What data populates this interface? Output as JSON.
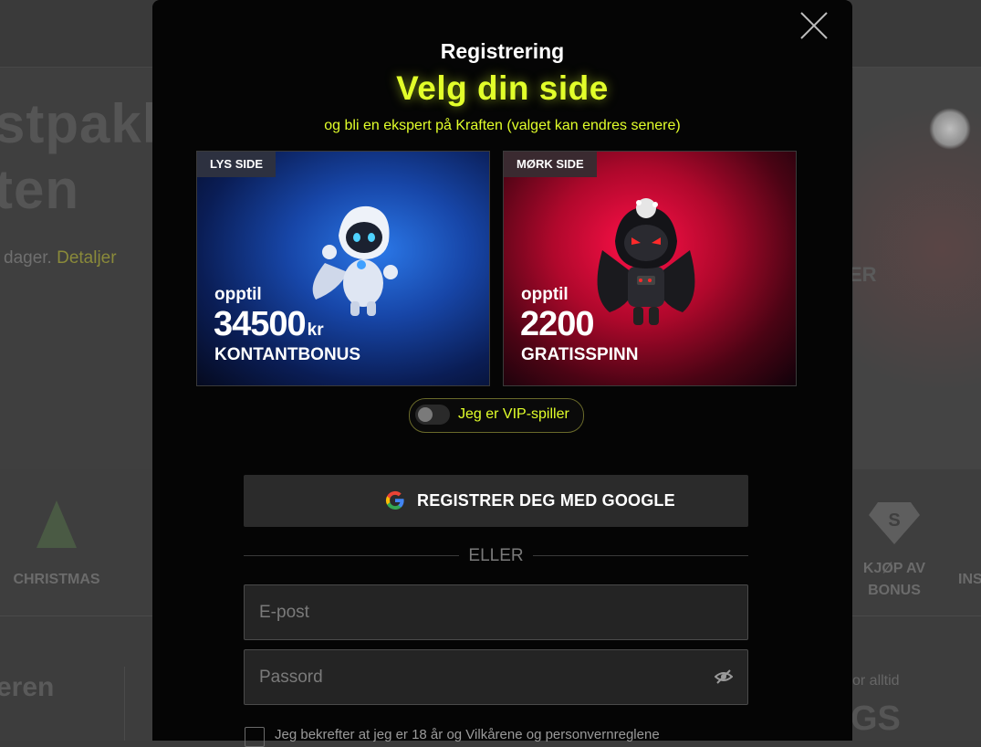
{
  "background": {
    "hero_title_line1": "stpakl",
    "hero_title_line2": "ten",
    "hero_sub": "dager.",
    "hero_link": "Detaljer",
    "right_letters": "ER",
    "categories": [
      {
        "label": "CHRISTMAS"
      },
      {
        "label": "KJØP AV BONUS"
      },
      {
        "label": "INS"
      }
    ],
    "bottom_left": "eren",
    "bottom_right_small": "or alltid",
    "bottom_right_big": "GS"
  },
  "modal": {
    "title": "Registrering",
    "headline": "Velg din side",
    "subline": "og bli en ekspert på Kraften (valget kan endres senere)",
    "light_card": {
      "tag": "LYS SIDE",
      "upto": "opptil",
      "amount": "34500",
      "unit": "kr",
      "kind": "KONTANTBONUS"
    },
    "dark_card": {
      "tag": "MØRK SIDE",
      "upto": "opptil",
      "amount": "2200",
      "kind": "GRATISSPINN"
    },
    "vip_label": "Jeg er VIP-spiller",
    "vip_on": false,
    "google_button": "REGISTRER DEG MED GOOGLE",
    "or_text": "ELLER",
    "email_placeholder": "E-post",
    "password_placeholder": "Passord",
    "terms_text": "Jeg bekrefter at jeg er 18 år og Vilkårene og personvernreglene"
  },
  "colors": {
    "accent": "#e2ff2a",
    "modal_bg": "#050505",
    "overlay_bg": "#3d3d3d"
  }
}
